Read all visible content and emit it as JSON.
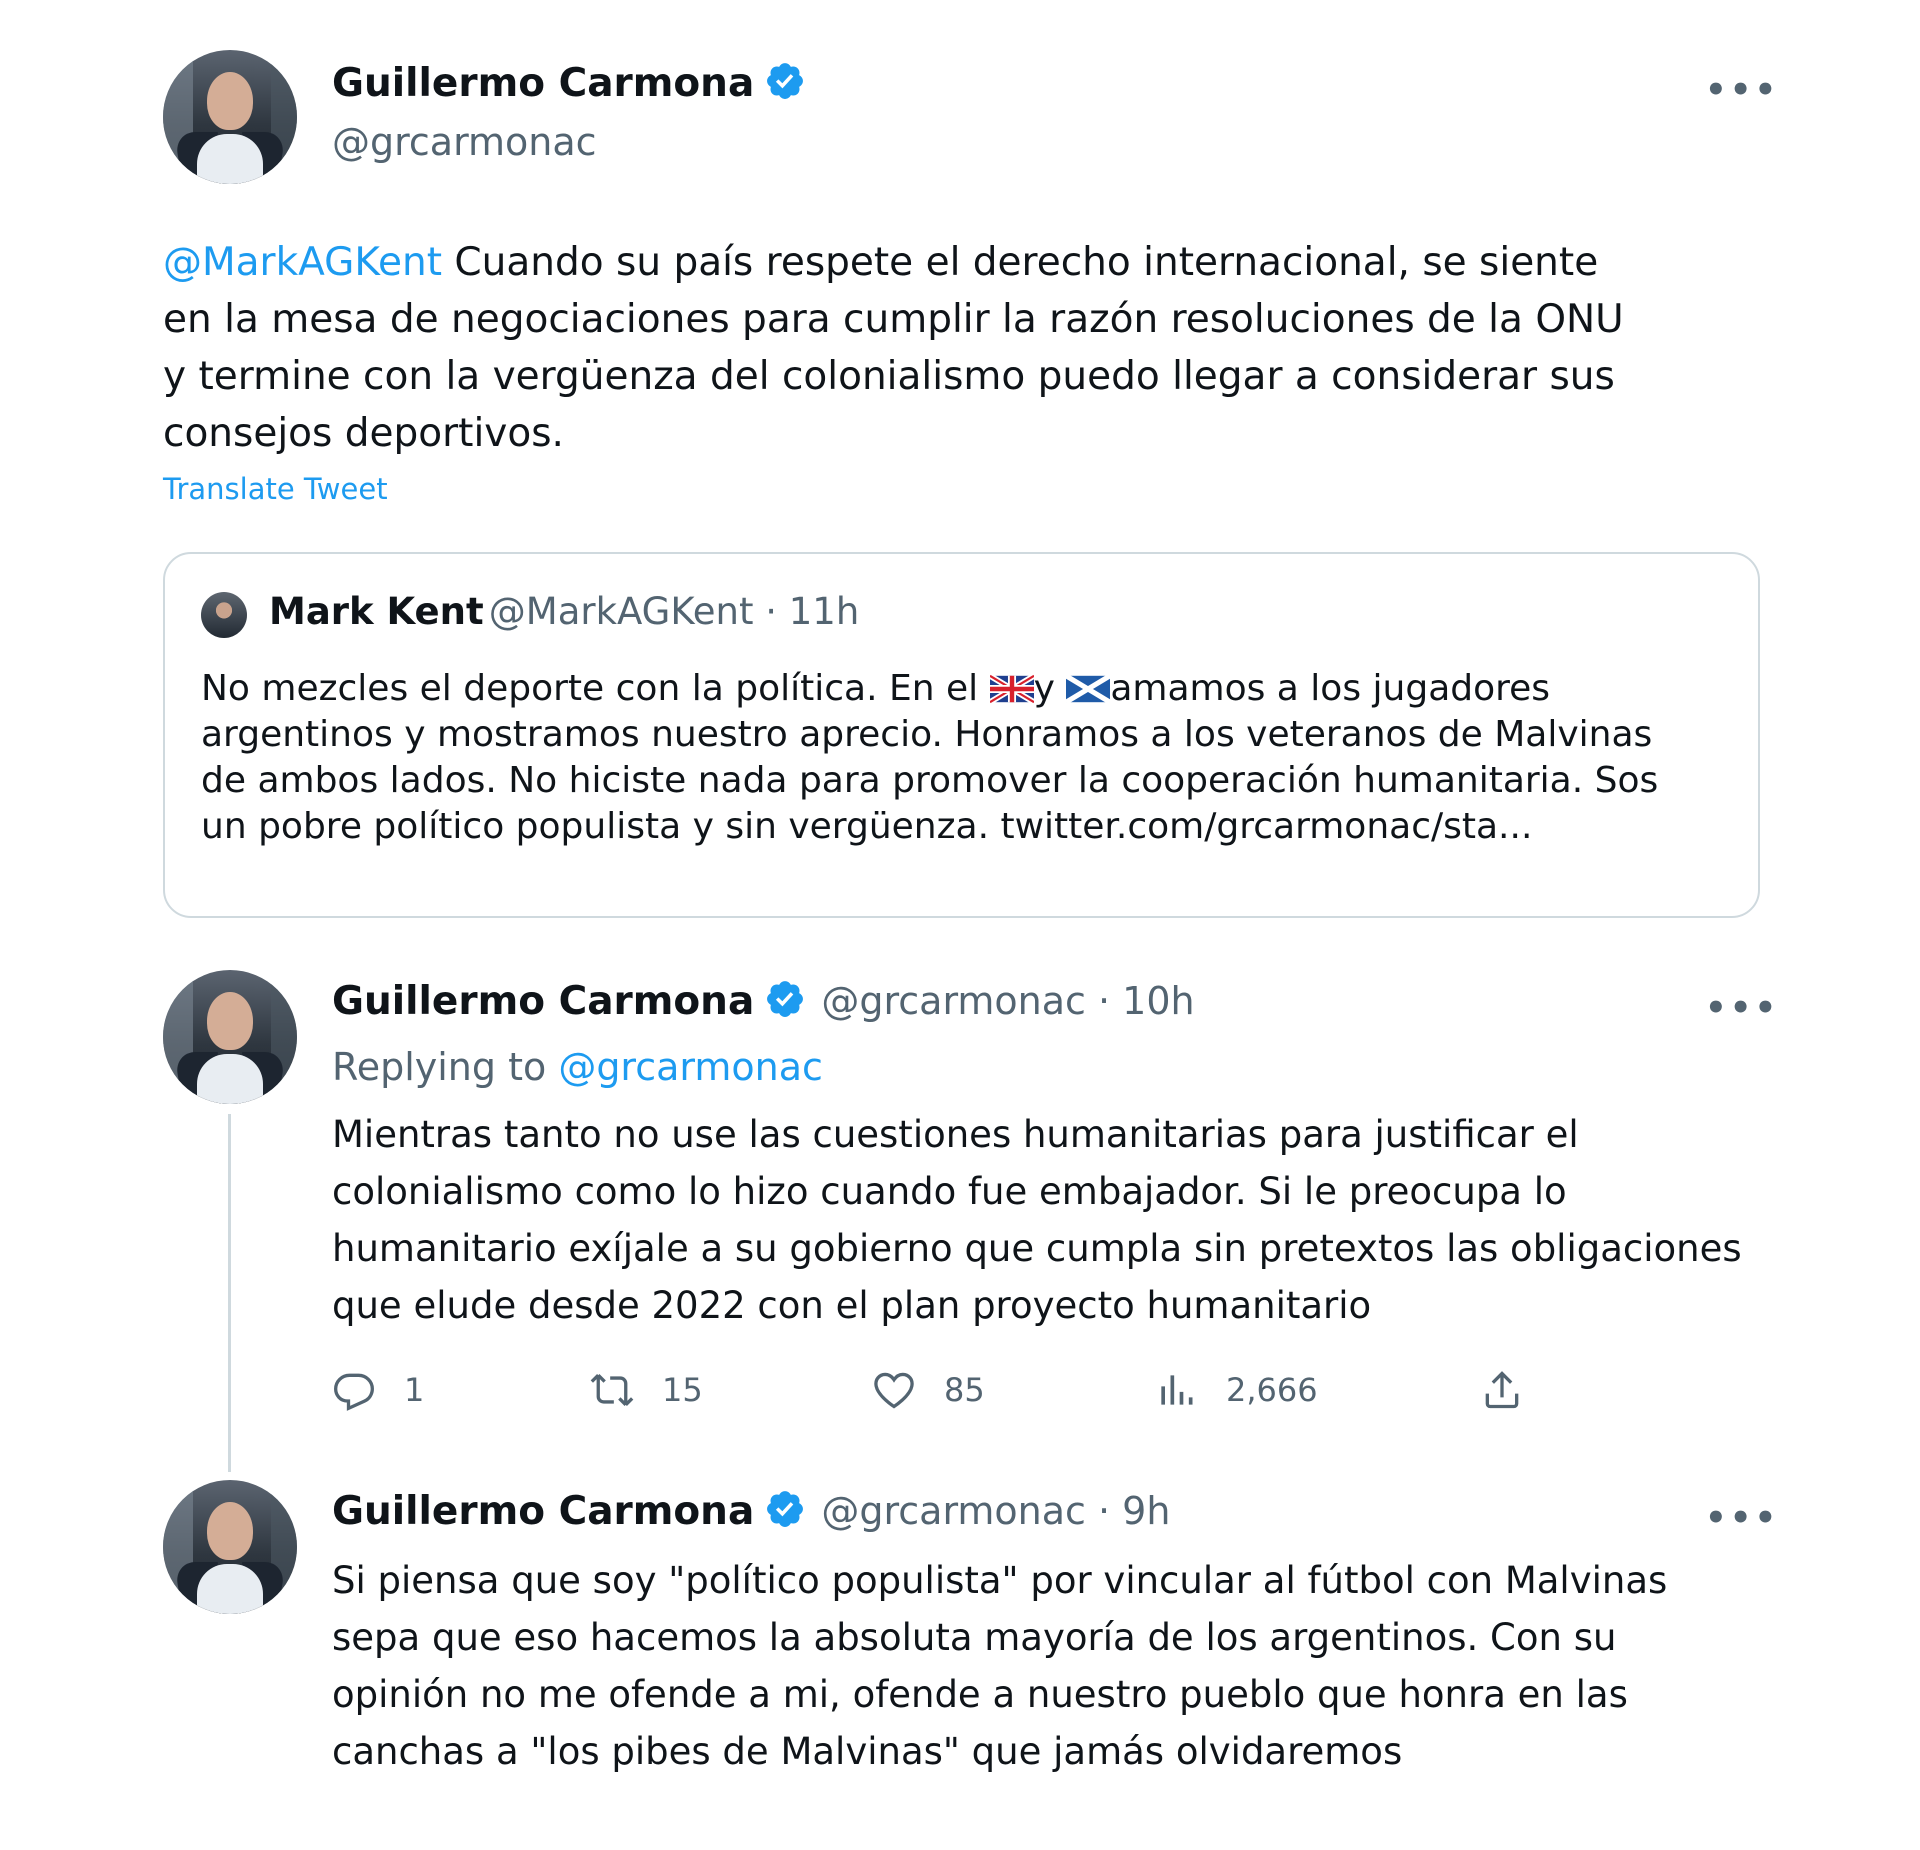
{
  "main_tweet": {
    "name": "Guillermo Carmona",
    "handle": "@grcarmonac",
    "mention": "@MarkAGKent",
    "text_lines": [
      " Cuando su país respete el derecho internacional, se siente",
      "en la mesa de negociaciones para cumplir la razón resoluciones de la ONU",
      "y termine con la vergüenza del colonialismo puedo llegar a considerar sus",
      "consejos deportivos."
    ],
    "translate_label": "Translate Tweet",
    "more_label": "•••"
  },
  "quoted_tweet": {
    "name": "Mark Kent",
    "handle_time": "@MarkAGKent · 11h",
    "line1_a": "No mezcles el deporte con la política.  En el ",
    "line1_b": "y ",
    "line1_c": "amamos a los jugadores",
    "text_lines": [
      "argentinos y mostramos nuestro aprecio. Honramos a los veteranos de Malvinas",
      "de ambos lados. No hiciste nada para promover la cooperación humanitaria. Sos",
      "un pobre político populista y sin vergüenza. twitter.com/grcarmonac/sta..."
    ]
  },
  "reply_1": {
    "name": "Guillermo Carmona",
    "handle_time": "@grcarmonac · 10h",
    "replying_prefix": "Replying to ",
    "replying_to": "@grcarmonac",
    "text_lines": [
      "Mientras tanto no use las cuestiones humanitarias para justificar el",
      "colonialismo como lo hizo cuando fue embajador. Si le preocupa lo",
      "humanitario exíjale a su gobierno que cumpla sin pretextos las obligaciones",
      "que elude desde 2022 con el plan proyecto humanitario"
    ],
    "actions": {
      "replies": "1",
      "retweets": "15",
      "likes": "85",
      "views": "2,666"
    },
    "more_label": "•••"
  },
  "reply_2": {
    "name": "Guillermo Carmona",
    "handle_time": "@grcarmonac · 9h",
    "text_lines": [
      "Si piensa que soy \"político populista\" por vincular al fútbol con Malvinas",
      "sepa que eso hacemos la absoluta mayoría de los argentinos. Con su",
      "opinión no me ofende a mi, ofende a nuestro pueblo que honra en las",
      "canchas a \"los pibes de Malvinas\" que jamás olvidaremos"
    ],
    "more_label": "•••"
  },
  "colors": {
    "accent": "#1d9bf0",
    "secondary_text": "#536471",
    "border": "#cfd9de"
  },
  "icons": [
    "verified-badge-icon",
    "more-icon",
    "reply-icon",
    "retweet-icon",
    "like-icon",
    "views-icon",
    "share-icon",
    "uk-flag-icon",
    "scotland-flag-icon"
  ]
}
